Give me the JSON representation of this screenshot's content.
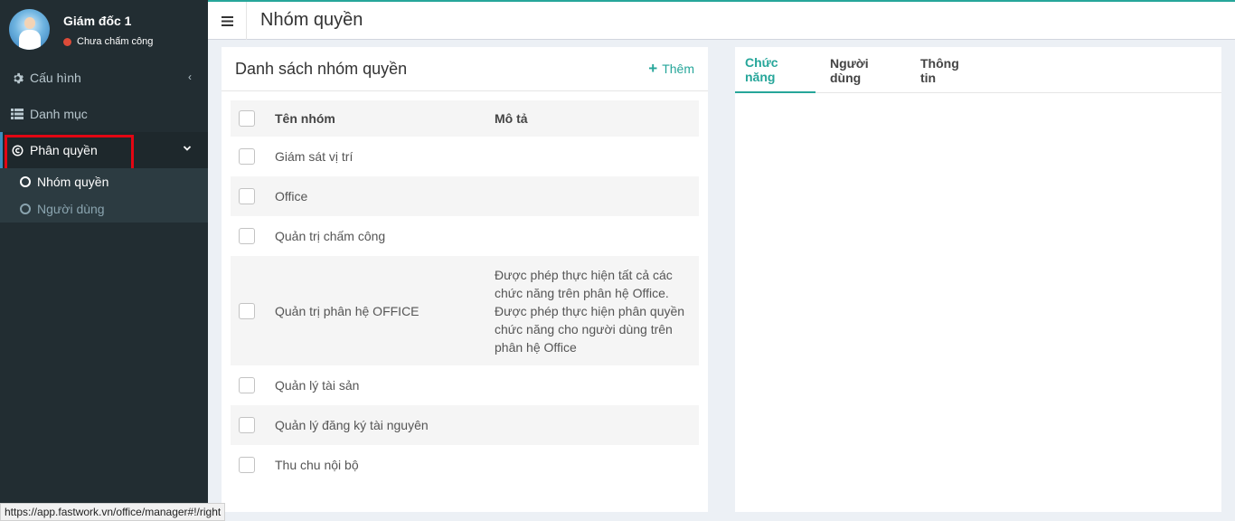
{
  "user": {
    "name": "Giám đốc 1",
    "status": "Chưa chấm công",
    "status_color": "#dd4b39"
  },
  "sidebar": {
    "items": [
      {
        "label": "Cấu hình",
        "icon": "gear-icon",
        "chevron": "‹"
      },
      {
        "label": "Danh mục",
        "icon": "list-icon"
      },
      {
        "label": "Phân quyền",
        "icon": "copyright-icon",
        "chevron": "⌄"
      }
    ],
    "submenu": [
      {
        "label": "Nhóm quyền",
        "active": true
      },
      {
        "label": "Người dùng",
        "active": false
      }
    ]
  },
  "header": {
    "menu_icon": "hamburger-icon",
    "title": "Nhóm quyền"
  },
  "groups": {
    "title": "Danh sách nhóm quyền",
    "add_label": "Thêm",
    "columns": {
      "name": "Tên nhóm",
      "desc": "Mô tả"
    },
    "rows": [
      {
        "name": "Giám sát vị trí",
        "desc": ""
      },
      {
        "name": "Office",
        "desc": ""
      },
      {
        "name": "Quản trị chấm công",
        "desc": ""
      },
      {
        "name": "Quản trị phân hệ OFFICE",
        "desc": "Được phép thực hiện tất cả các chức năng trên phân hệ Office. Được phép thực hiện phân quyền chức năng cho người dùng trên phân hệ Office"
      },
      {
        "name": "Quản lý tài sản",
        "desc": ""
      },
      {
        "name": "Quản lý đăng ký tài nguyên",
        "desc": ""
      },
      {
        "name": "Thu chu nội bộ",
        "desc": ""
      }
    ]
  },
  "tabs": [
    {
      "label": "Chức năng",
      "active": true
    },
    {
      "label": "Người dùng",
      "active": false
    },
    {
      "label": "Thông tin",
      "active": false
    }
  ],
  "status_url": "https://app.fastwork.vn/office/manager#!/right",
  "colors": {
    "accent": "#26a69a",
    "sidebar": "#222d32",
    "highlight": "#e30613"
  }
}
